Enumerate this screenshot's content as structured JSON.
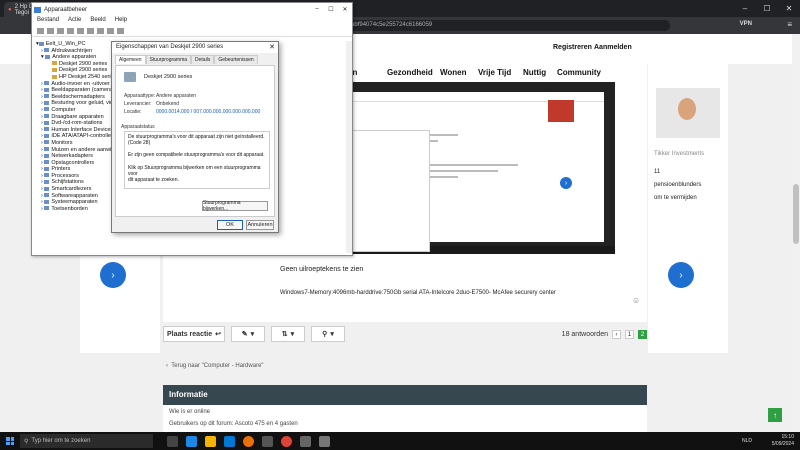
{
  "browser": {
    "tab_title": "2 Hp Deskjet 2900 series - Tegoi",
    "url": "...e359b1036a80abf94074c5e255724c6166059",
    "vpn_label": "VPN",
    "menu_icon": "hamburger-icon"
  },
  "site": {
    "auth": {
      "register": "Registreren",
      "login": "Aanmelden"
    },
    "nav": [
      "rgen",
      "Gezondheid",
      "Wonen",
      "Vrije Tijd",
      "Nuttig",
      "Community"
    ],
    "post": {
      "caption": "Geen uilroeptekens te zien",
      "specs": "Windows7-Memory:4096mb-harddrive:750Gb serial ATA-Intelcore 2duo-E7500- McAfee securery center"
    },
    "actions": {
      "reply": "Plaats reactie",
      "answers": "18 antwoorden",
      "pages": [
        "1",
        "2"
      ]
    },
    "back_link": "Terug naar \"Computer - Hardware\"",
    "info": {
      "title": "Informatie",
      "who_online": "Wie is er online",
      "users_line": "Gebruikers op dit forum: Ascoto 475 en 4 gasten"
    },
    "promo": {
      "title": "Tikker Investments",
      "lines": [
        "11",
        "pensioenblunders",
        "om te vermijden"
      ]
    }
  },
  "device_manager": {
    "title": "Apparaatbeheer",
    "menu": [
      "Bestand",
      "Actie",
      "Beeld",
      "Help"
    ],
    "tree": [
      "Eelt_U_Win_PC",
      "Afdrukwachtrijen",
      "Andere apparaten",
      "Deskjet 2900 series",
      "Deskjet 2900 series",
      "HP Deskjet 2540 series",
      "Audio-invoer en -uitvoer",
      "Beeldapparaten (camera)",
      "Beeldschermadapters",
      "Besturing voor geluid, video",
      "Computer",
      "Draagbare apparaten",
      "Dvd-/cd-rom-stations",
      "Human Interface Devices",
      "IDE ATA/ATAPI-controllers",
      "Monitors",
      "Muizen en andere aanwijsapparaten",
      "Netwerkadapters",
      "Opslagcontrollers",
      "Printers",
      "Processors",
      "Schijfstations",
      "Smartcardlezers",
      "Softwareapparaten",
      "Systeemapparaten",
      "Toetsenborden"
    ]
  },
  "properties": {
    "title": "Eigenschappen van Deskjet 2900 series",
    "tabs": [
      "Algemeen",
      "Stuurprogramma",
      "Details",
      "Gebeurtenissen"
    ],
    "device_name": "Deskjet 2900 series",
    "rows": [
      {
        "label": "Apparaattype:",
        "value": "Andere apparaten"
      },
      {
        "label": "Leverancier:",
        "value": "Onbekend"
      },
      {
        "label": "Locatie:",
        "value": "0000.0014.000 / 007.000.000.000.000.000.000"
      }
    ],
    "status_group": "Apparaatstatus",
    "status_lines": [
      "De stuurprogramma's voor dit apparaat zijn niet geïnstalleerd.",
      "(Code 28)",
      "",
      "Er zijn geen compatibele stuurprogramma's voor dit apparaat.",
      "",
      "Klik op Stuurprogramma bijwerken om een stuurprogramma voor",
      "dit apparaat te zoeken."
    ],
    "update_button": "Stuurprogramma bijwerken...",
    "ok": "OK",
    "cancel": "Annuleren"
  },
  "taskbar": {
    "search_placeholder": "Typ hier om te zoeken",
    "lang": "NLD",
    "time": "15:10",
    "date": "5/09/2024"
  }
}
